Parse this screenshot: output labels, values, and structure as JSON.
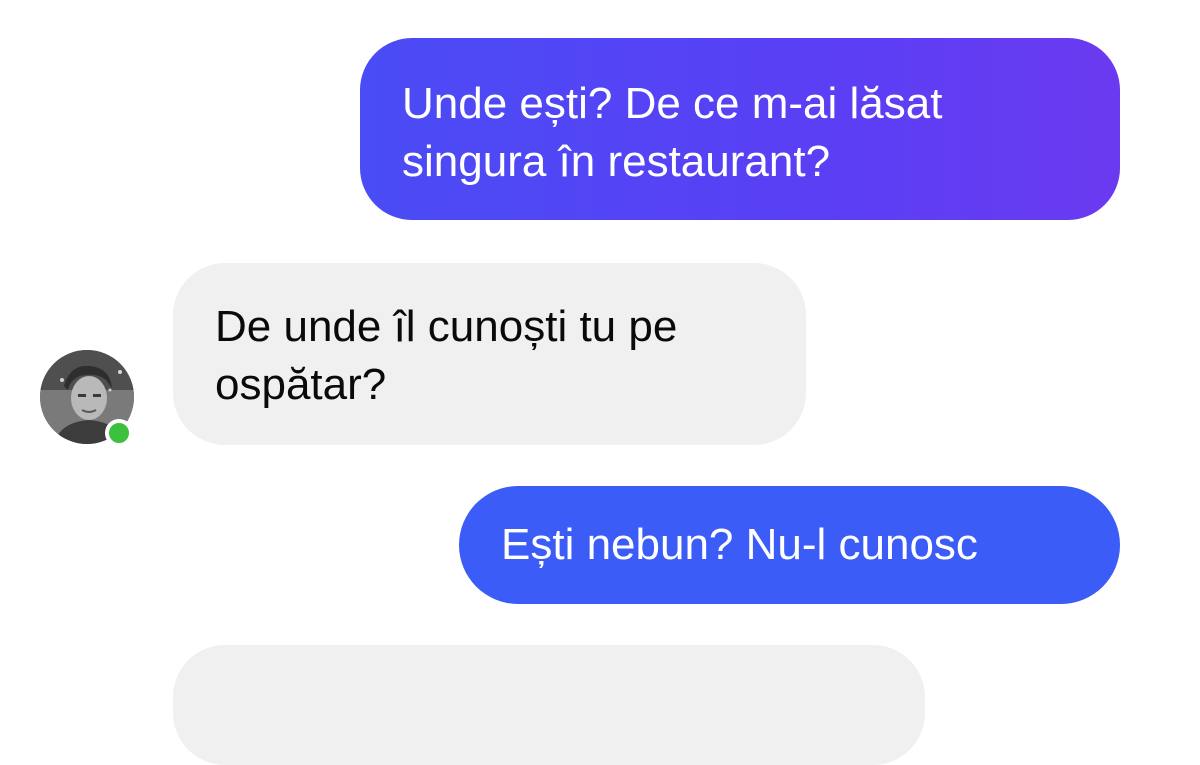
{
  "messages": [
    {
      "direction": "sent",
      "text": "Unde ești? De ce m-ai lăsat\nsingura în restaurant?"
    },
    {
      "direction": "received",
      "text": "De unde îl cunoști tu pe\nospătar?"
    },
    {
      "direction": "sent",
      "text": "Ești nebun?  Nu-l cunosc"
    },
    {
      "direction": "received",
      "text": ""
    }
  ],
  "contact": {
    "avatar_icon": "person-photo-avatar",
    "status": "online",
    "status_color": "#3cc13c"
  },
  "colors": {
    "sent_bubble": "#4a4cf5",
    "sent_bubble_2": "#3b5cf7",
    "received_bubble": "#f0f0f0"
  }
}
